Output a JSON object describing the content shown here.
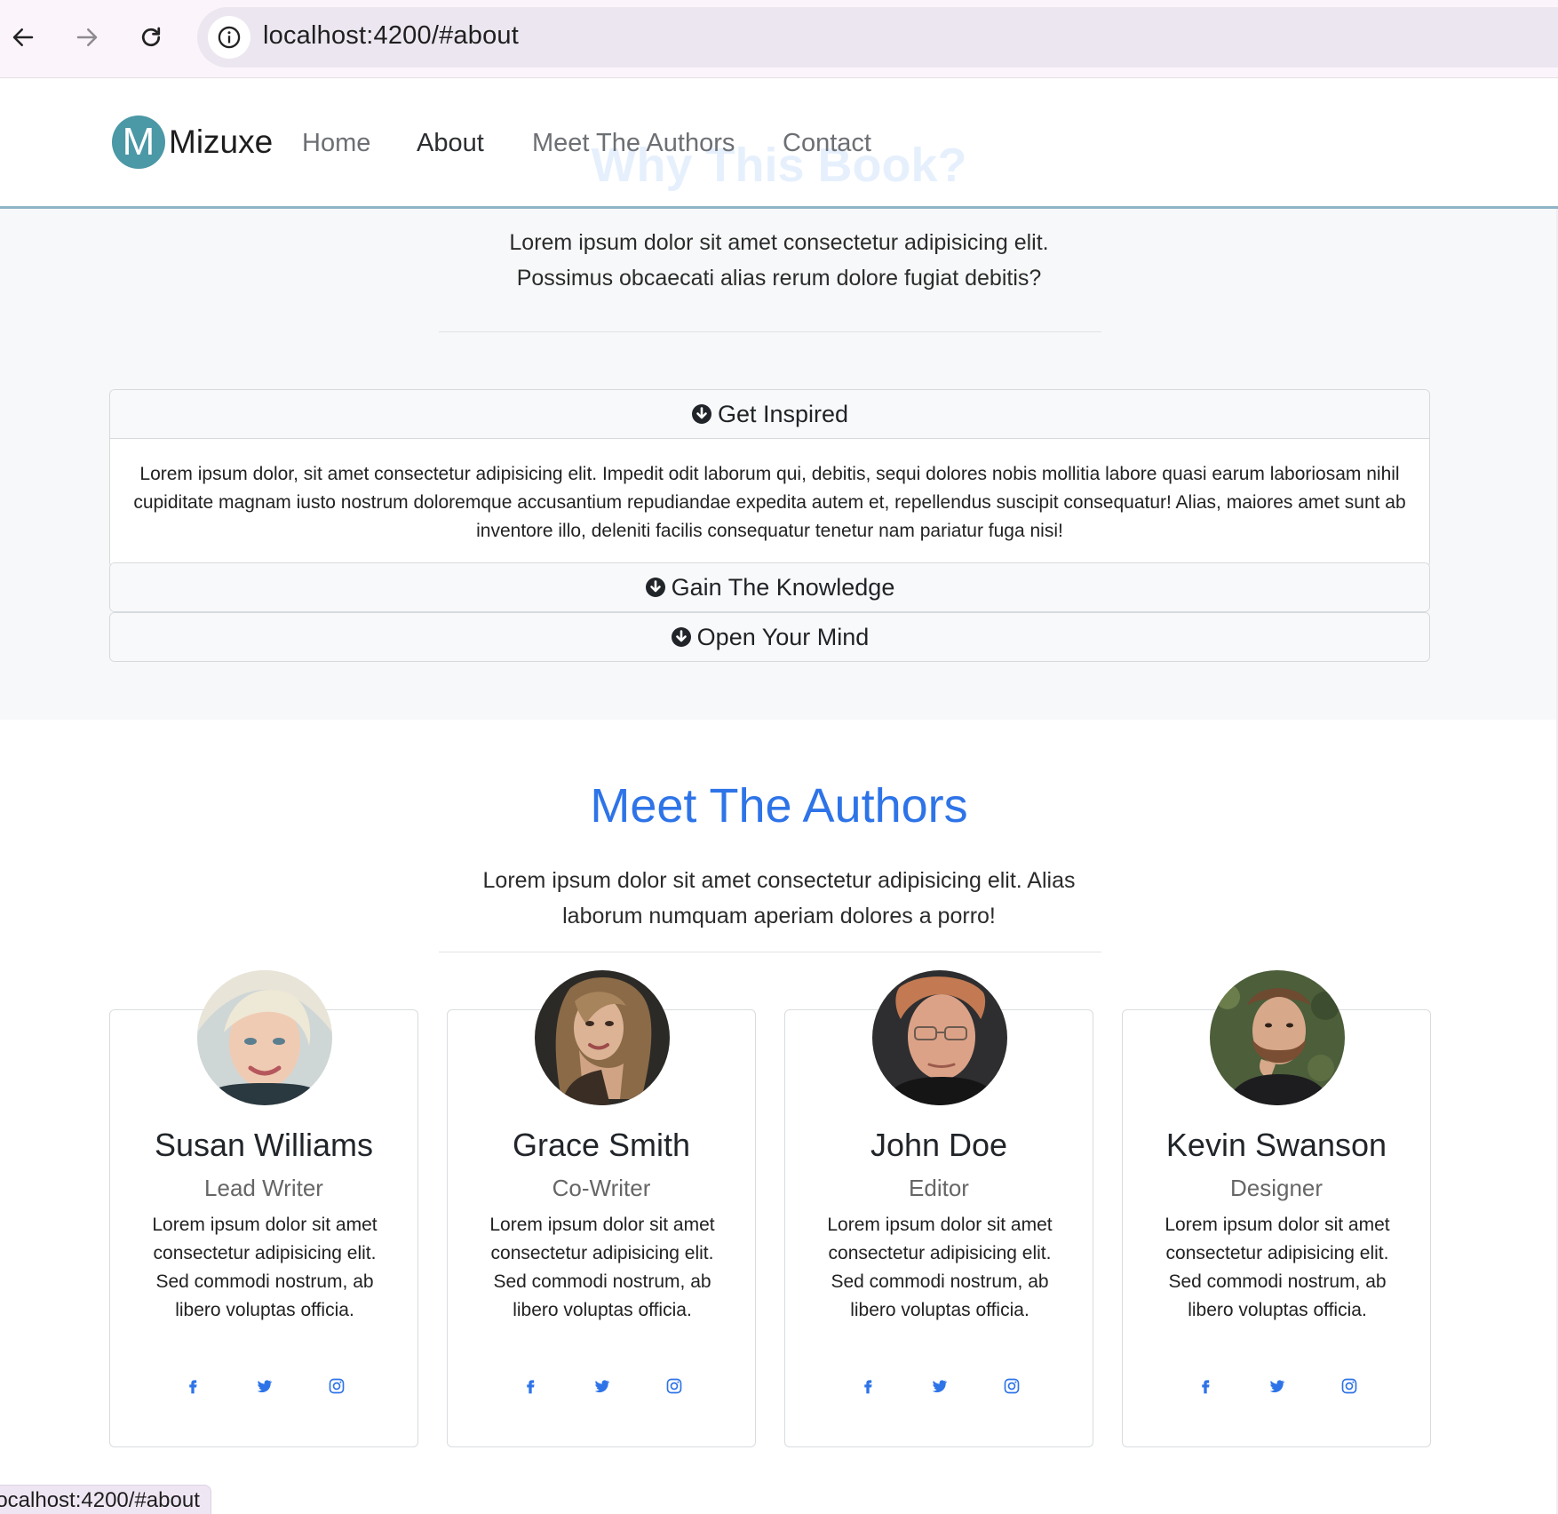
{
  "browser": {
    "url": "localhost:4200/#about",
    "status_url": "localhost:4200/#about"
  },
  "navbar": {
    "logo_letter": "M",
    "brand": "Mizuxe",
    "links": [
      "Home",
      "About",
      "Meet The Authors",
      "Contact"
    ],
    "active": "About"
  },
  "about": {
    "title": "Why This Book?",
    "lead_line1": "Lorem ipsum dolor sit amet consectetur adipisicing elit.",
    "lead_line2": "Possimus obcaecati alias rerum dolore fugiat debitis?",
    "accordion": [
      {
        "title": "Get Inspired",
        "body": "Lorem ipsum dolor, sit amet consectetur adipisicing elit. Impedit odit laborum qui, debitis, sequi dolores nobis mollitia labore quasi earum laboriosam nihil cupiditate magnam iusto nostrum doloremque accusantium repudiandae expedita autem et, repellendus suscipit consequatur! Alias, maiores amet sunt ab inventore illo, deleniti facilis consequatur tenetur nam pariatur fuga nisi!"
      },
      {
        "title": "Gain The Knowledge"
      },
      {
        "title": "Open Your Mind"
      }
    ]
  },
  "authors": {
    "title": "Meet The Authors",
    "lead_line1": "Lorem ipsum dolor sit amet consectetur adipisicing elit. Alias",
    "lead_line2": "laborum numquam aperiam dolores a porro!",
    "cards": [
      {
        "name": "Susan Williams",
        "role": "Lead Writer",
        "text": "Lorem ipsum dolor sit amet consectetur adipisicing elit. Sed commodi nostrum, ab libero voluptas officia."
      },
      {
        "name": "Grace Smith",
        "role": "Co-Writer",
        "text": "Lorem ipsum dolor sit amet consectetur adipisicing elit. Sed commodi nostrum, ab libero voluptas officia."
      },
      {
        "name": "John Doe",
        "role": "Editor",
        "text": "Lorem ipsum dolor sit amet consectetur adipisicing elit. Sed commodi nostrum, ab libero voluptas officia."
      },
      {
        "name": "Kevin Swanson",
        "role": "Designer",
        "text": "Lorem ipsum dolor sit amet consectetur adipisicing elit. Sed commodi nostrum, ab libero voluptas officia."
      }
    ],
    "social_icons": [
      "facebook-icon",
      "twitter-icon",
      "instagram-icon"
    ]
  },
  "colors": {
    "accent_blue": "#2e74e8",
    "logo_teal": "#4b98a6",
    "section_bg": "#f7f8f9"
  }
}
